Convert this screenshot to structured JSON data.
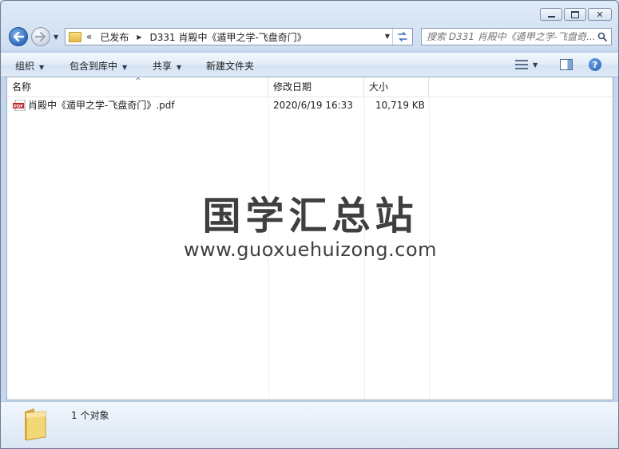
{
  "window": {
    "caption_buttons": [
      "minimize-icon",
      "maximize-icon",
      "close-icon"
    ]
  },
  "address": {
    "overflow": "«",
    "segments": [
      "已发布",
      "D331 肖殿中《遁甲之学-飞盘奇门》"
    ]
  },
  "search": {
    "placeholder": "搜索 D331 肖殿中《遁甲之学-飞盘奇..."
  },
  "toolbar": {
    "organize": "组织",
    "include_library": "包含到库中",
    "share": "共享",
    "new_folder": "新建文件夹"
  },
  "columns": {
    "name": "名称",
    "modified": "修改日期",
    "size": "大小"
  },
  "files": [
    {
      "icon": "pdf-file-icon",
      "name": "肖殿中《遁甲之学-飞盘奇门》.pdf",
      "modified": "2020/6/19 16:33",
      "size": "10,719 KB"
    }
  ],
  "watermark": {
    "title": "国学汇总站",
    "url": "www.guoxuehuizong.com"
  },
  "status": {
    "count": "1 个对象"
  },
  "colors": {
    "pdf_red": "#c0262c",
    "folder_yellow": "#e9c25a",
    "accent_blue": "#2f6cc0"
  }
}
